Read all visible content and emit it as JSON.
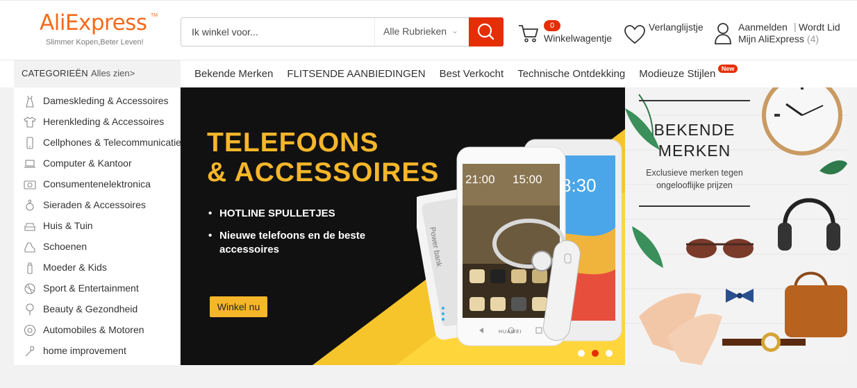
{
  "header": {
    "logo_text": "AliExpress",
    "logo_tm": "TM",
    "tagline": "Slimmer Kopen,Beter Leven!",
    "search_placeholder": "Ik winkel voor...",
    "search_category": "Alle Rubrieken",
    "cart_count": "0",
    "cart_label": "Winkelwagentje",
    "wishlist_label": "Verlanglijstje",
    "signin_label": "Aanmelden",
    "separator": "|",
    "join_label": "Wordt Lid",
    "my_account_label": "Mijn AliExpress",
    "my_account_count": "(4)"
  },
  "nav": {
    "categories_title": "CATEGORIEËN",
    "see_all": "Alles zien>",
    "links": [
      "Bekende Merken",
      "FLITSENDE AANBIEDINGEN",
      "Best Verkocht",
      "Technische Ontdekking",
      "Modieuze Stijlen"
    ],
    "new_badge": "New"
  },
  "sidebar": {
    "items": [
      {
        "label": "Dameskleding & Accessoires",
        "icon": "dress-icon"
      },
      {
        "label": "Herenkleding & Accessoires",
        "icon": "shirt-icon"
      },
      {
        "label": "Cellphones & Telecommunicatie",
        "icon": "phone-icon"
      },
      {
        "label": "Computer & Kantoor",
        "icon": "laptop-icon"
      },
      {
        "label": "Consumentenelektronica",
        "icon": "camera-icon"
      },
      {
        "label": "Sieraden & Accessoires",
        "icon": "ring-icon"
      },
      {
        "label": "Huis & Tuin",
        "icon": "sofa-icon"
      },
      {
        "label": "Schoenen",
        "icon": "shoe-icon"
      },
      {
        "label": "Moeder & Kids",
        "icon": "bottle-icon"
      },
      {
        "label": "Sport & Entertainment",
        "icon": "ball-icon"
      },
      {
        "label": "Beauty & Gezondheid",
        "icon": "mirror-icon"
      },
      {
        "label": "Automobiles & Motoren",
        "icon": "wheel-icon"
      },
      {
        "label": "home improvement",
        "icon": "tools-icon"
      }
    ]
  },
  "banner": {
    "title_line1": "TELEFOONS",
    "title_line2": "& ACCESSOIRES",
    "bullets": [
      "HOTLINE SPULLETJES",
      "Nieuwe telefoons en de beste accessoires"
    ],
    "cta": "Winkel nu",
    "phone_brand": "HUAWEI",
    "powerbank_text": "Power bank",
    "slide_count": 3,
    "active_slide": 2
  },
  "side_banner": {
    "title_line1": "BEKENDE",
    "title_line2": "MERKEN",
    "subtitle": "Exclusieve merken tegen ongelooflijke prijzen"
  },
  "colors": {
    "brand_orange": "#f46a1b",
    "action_red": "#e62e04",
    "banner_yellow": "#f5b629"
  }
}
